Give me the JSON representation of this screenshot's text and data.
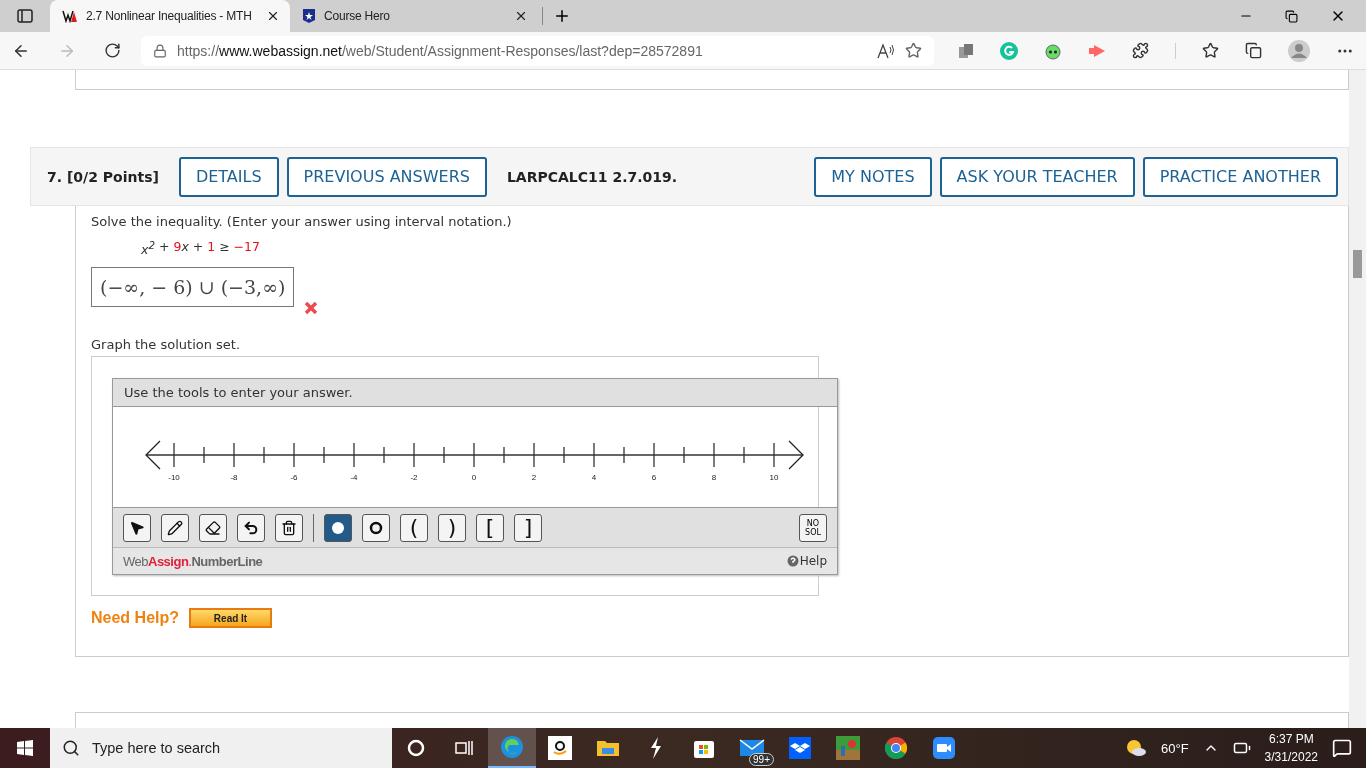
{
  "browser": {
    "tabs": [
      {
        "title": "2.7 Nonlinear Inequalities - MTH",
        "kind": "webassign",
        "selected": true
      },
      {
        "title": "Course Hero",
        "kind": "coursehero",
        "selected": false
      }
    ],
    "url_scheme": "https://",
    "url_host": "www.webassign.net",
    "url_path": "/web/Student/Assignment-Responses/last?dep=28572891"
  },
  "question": {
    "number": "7.",
    "points": "[0/2 Points]",
    "left_buttons": [
      "DETAILS",
      "PREVIOUS ANSWERS"
    ],
    "code": "LARPCALC11 2.7.019.",
    "right_buttons": [
      "MY NOTES",
      "ASK YOUR TEACHER",
      "PRACTICE ANOTHER"
    ],
    "prompt": "Solve the inequality. (Enter your answer using interval notation.)",
    "inequality": [
      {
        "text": "x$^{2}$",
        "kind": "var"
      },
      {
        "text": " + ",
        "kind": "op"
      },
      {
        "text": "9",
        "kind": "num"
      },
      {
        "text": "x",
        "kind": "var"
      },
      {
        "text": " + ",
        "kind": "op"
      },
      {
        "text": "1",
        "kind": "num"
      },
      {
        "text": " ≥ ",
        "kind": "op"
      },
      {
        "text": "−17",
        "kind": "num"
      }
    ],
    "answer": "(−∞, − 6) ∪ (−3,∞)",
    "correct": false,
    "graph_prompt": "Graph the solution set.",
    "numberline": {
      "instruction": "Use the tools to enter your answer.",
      "tick_labels": [
        "-10",
        "-8",
        "-6",
        "-4",
        "-2",
        "0",
        "2",
        "4",
        "6",
        "8",
        "10"
      ],
      "tools": [
        {
          "kind": "pointer",
          "selected": false
        },
        {
          "kind": "pencil",
          "selected": false
        },
        {
          "kind": "eraser",
          "selected": false
        },
        {
          "kind": "undo",
          "selected": false
        },
        {
          "kind": "trash",
          "selected": false
        },
        {
          "kind": "closed-dot",
          "selected": true
        },
        {
          "kind": "open-dot",
          "selected": false
        },
        {
          "kind": "glyph",
          "label": "(",
          "selected": false
        },
        {
          "kind": "glyph",
          "label": ")",
          "selected": false
        },
        {
          "kind": "glyph",
          "label": "[",
          "selected": false
        },
        {
          "kind": "glyph",
          "label": "]",
          "selected": false
        }
      ],
      "no_solution": "NO SOL",
      "brand_web": "Web",
      "brand_assign": "Assign",
      "brand_dot": ".",
      "brand_product": "NumberLine",
      "help": "Help"
    },
    "need_help": "Need Help?",
    "read_it": "Read It"
  },
  "taskbar": {
    "search_placeholder": "Type here to search",
    "mail_badge": "99+",
    "weather": "60°F",
    "time": "6:37 PM",
    "date": "3/31/2022"
  }
}
